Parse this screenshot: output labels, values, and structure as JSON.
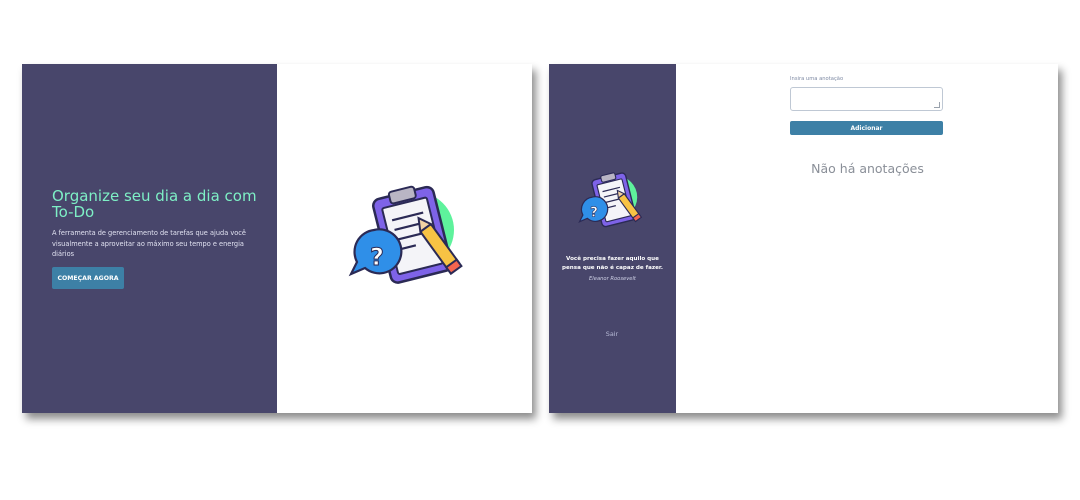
{
  "landing": {
    "title": "Organize seu dia a dia com To-Do",
    "description": "A ferramenta de gerenciamento de tarefas que ajuda você visualmente a aproveitar ao máximo seu tempo e energia diários",
    "cta_label": "COMEÇAR AGORA",
    "illustration": "clipboard-pencil-question-icon"
  },
  "app": {
    "sidebar": {
      "illustration": "clipboard-pencil-question-icon",
      "quote": "Você precisa fazer aquilo que pensa que não é capaz de fazer.",
      "quote_author": "Eleanor Roosevelt",
      "logout_label": "Sair"
    },
    "note_form": {
      "label": "Insira uma anotação",
      "value": "",
      "add_label": "Adicionar"
    },
    "empty_message": "Não há anotações"
  },
  "colors": {
    "sidebar": "#48466b",
    "accent": "#3d80a6",
    "title_green": "#7ef0c6",
    "blob_green": "#5ef29c",
    "clipboard_purple": "#7e63e8",
    "bubble_blue": "#2f8fe8",
    "pencil_yellow": "#f7c344"
  }
}
